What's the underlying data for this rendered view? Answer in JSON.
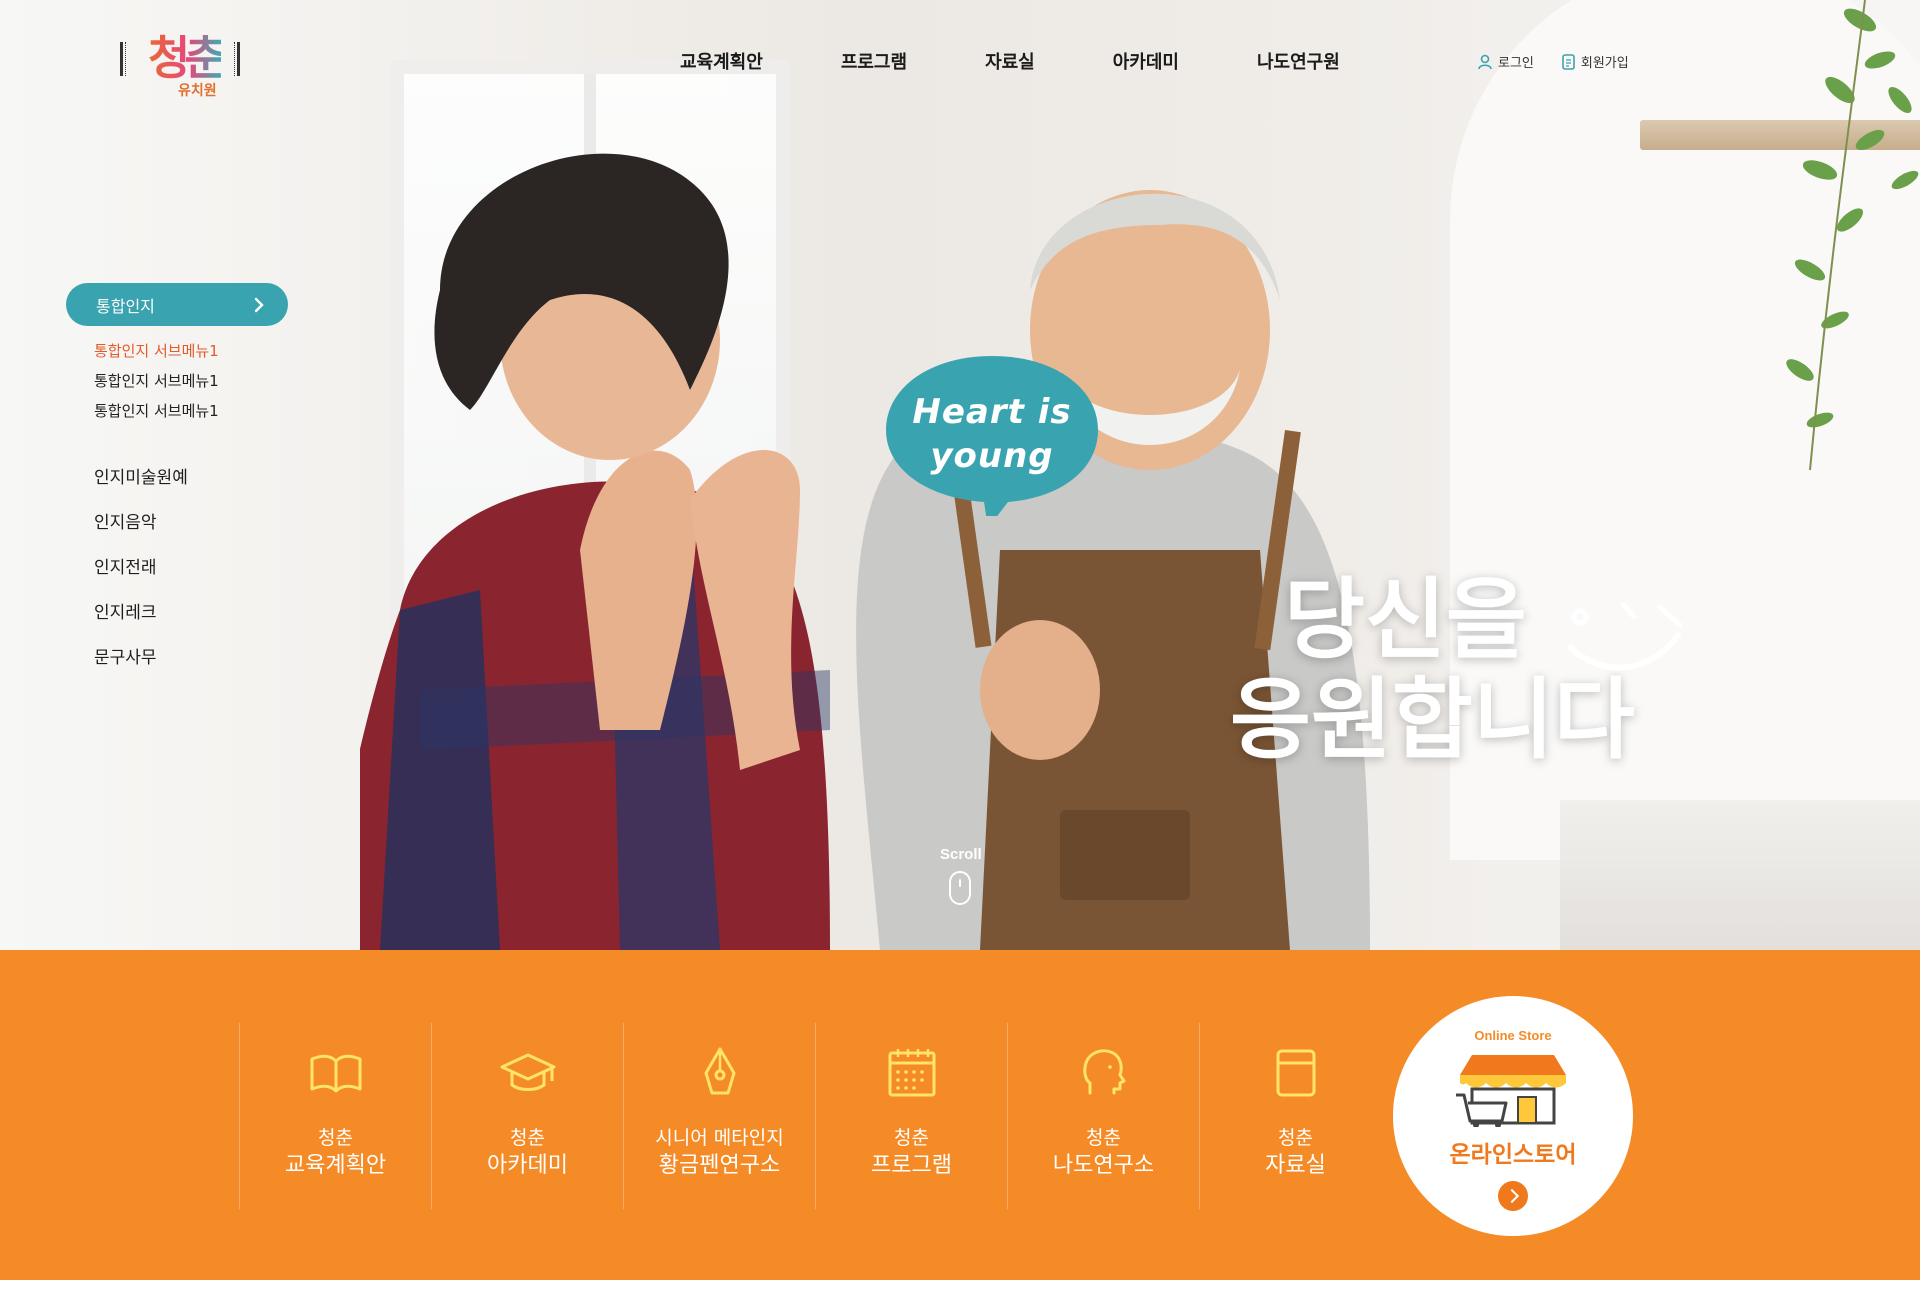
{
  "brand": {
    "logo_text": "청춘",
    "logo_sub": "유치원"
  },
  "header": {
    "nav": [
      "교육계획안",
      "프로그램",
      "자료실",
      "아카데미",
      "나도연구원"
    ],
    "login_label": "로그인",
    "signup_label": "회원가입",
    "login_icon": "person-icon",
    "signup_icon": "document-icon"
  },
  "side_nav": {
    "active_label": "통합인지",
    "sub_items": [
      "통합인지 서브메뉴1",
      "통합인지 서브메뉴1",
      "통합인지 서브메뉴1"
    ],
    "items": [
      "인지미술원예",
      "인지음악",
      "인지전래",
      "인지레크",
      "문구사무"
    ],
    "accent_color": "#3aa3b0",
    "active_sub_color": "#e55a2d"
  },
  "hero": {
    "bubble_line1": "Heart is",
    "bubble_line2": "young",
    "headline_line1": "당신을",
    "headline_line2": "응원합니다",
    "scroll_label": "Scroll",
    "bubble_color": "#3aa3b0"
  },
  "quick_menu": {
    "background": "#f58b27",
    "items": [
      {
        "line1": "청춘",
        "line2": "교육계획안",
        "icon": "open-book-icon"
      },
      {
        "line1": "청춘",
        "line2": "아카데미",
        "icon": "graduation-cap-icon"
      },
      {
        "line1": "시니어 메타인지",
        "line2": "황금펜연구소",
        "icon": "pen-nib-icon"
      },
      {
        "line1": "청춘",
        "line2": "프로그램",
        "icon": "calendar-icon"
      },
      {
        "line1": "청춘",
        "line2": "나도연구소",
        "icon": "head-profile-icon"
      },
      {
        "line1": "청춘",
        "line2": "자료실",
        "icon": "archive-box-icon"
      }
    ],
    "store": {
      "tag": "Online Store",
      "label": "온라인스토어",
      "icon": "shop-basket-icon"
    }
  }
}
